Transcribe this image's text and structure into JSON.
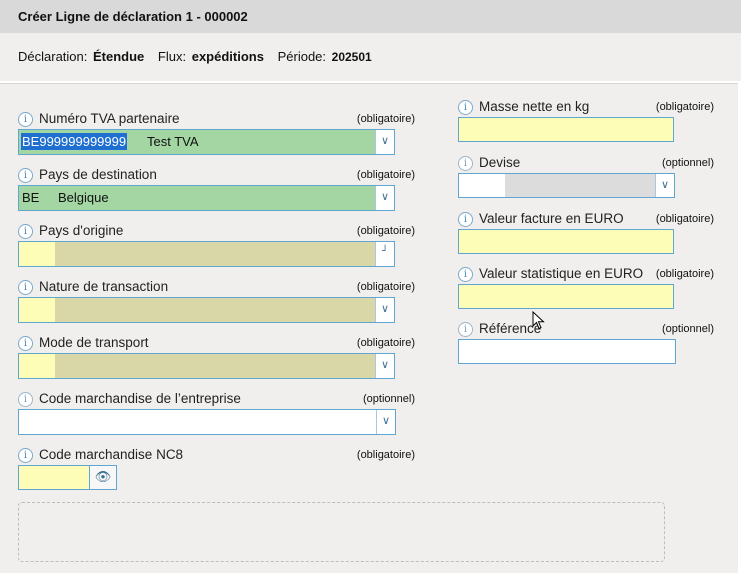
{
  "title": "Créer Ligne de déclaration 1 - 000002",
  "info": {
    "declaration_label": "Déclaration:",
    "declaration_value": "Étendue",
    "flux_label": "Flux:",
    "flux_value": "expéditions",
    "periode_label": "Période:",
    "periode_value": "202501"
  },
  "left": {
    "tva": {
      "label": "Numéro TVA partenaire",
      "req": "(obligatoire)",
      "code": "BE999999999999",
      "desc": "Test TVA"
    },
    "pays_dest": {
      "label": "Pays de destination",
      "req": "(obligatoire)",
      "code": "BE",
      "desc": "Belgique"
    },
    "pays_orig": {
      "label": "Pays d'origine",
      "req": "(obligatoire)",
      "code": "",
      "desc": ""
    },
    "nature": {
      "label": "Nature de transaction",
      "req": "(obligatoire)",
      "code": "",
      "desc": ""
    },
    "mode": {
      "label": "Mode de transport",
      "req": "(obligatoire)",
      "code": "",
      "desc": ""
    },
    "code_marchandise": {
      "label": "Code marchandise de l’entreprise",
      "req": "(optionnel)",
      "value": ""
    },
    "nc8": {
      "label": "Code marchandise NC8",
      "req": "(obligatoire)",
      "value": ""
    }
  },
  "right": {
    "masse": {
      "label": "Masse nette en kg",
      "req": "(obligatoire)",
      "value": ""
    },
    "devise": {
      "label": "Devise",
      "req": "(optionnel)",
      "code": "",
      "desc": ""
    },
    "valeur_facture": {
      "label": "Valeur facture en EURO",
      "req": "(obligatoire)",
      "value": ""
    },
    "valeur_stat": {
      "label": "Valeur statistique en EURO",
      "req": "(obligatoire)",
      "value": ""
    },
    "reference": {
      "label": "Référence",
      "req": "(optionnel)",
      "value": ""
    }
  },
  "icons": {
    "info": "info-icon",
    "dropdown": "chevron-down-icon",
    "lookup": "lookup-icon",
    "eye": "eye-icon"
  },
  "colors": {
    "valid_green": "#a3d6a3",
    "required_yellow": "#fdfdb8",
    "inactive_khaki": "#d9d7a8",
    "border_blue": "#5fa7d0",
    "selection_blue": "#1f6fd0"
  }
}
